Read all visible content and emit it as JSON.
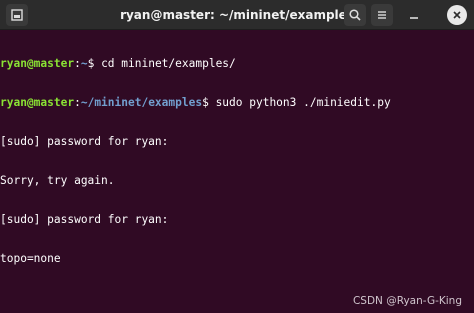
{
  "window": {
    "title": "ryan@master: ~/mininet/examples",
    "icons": {
      "new_tab": "new-tab-icon",
      "search": "search-icon",
      "menu": "hamburger-menu-icon",
      "minimize": "minimize-icon",
      "close": "close-icon"
    }
  },
  "terminal": {
    "lines": [
      {
        "user": "ryan@master",
        "sep": ":",
        "path": "~",
        "cmd": "$ cd mininet/examples/"
      },
      {
        "user": "ryan@master",
        "sep": ":",
        "path": "~/mininet/examples",
        "cmd": "$ sudo python3 ./miniedit.py"
      },
      {
        "text": "[sudo] password for ryan:"
      },
      {
        "text": "Sorry, try again."
      },
      {
        "text": "[sudo] password for ryan:"
      },
      {
        "text": "topo=none"
      }
    ]
  },
  "watermark": "CSDN @Ryan-G-King",
  "colors": {
    "background": "#300a24",
    "titlebar": "#2c2c2c",
    "prompt_user": "#8ae234",
    "prompt_path": "#729fcf"
  }
}
